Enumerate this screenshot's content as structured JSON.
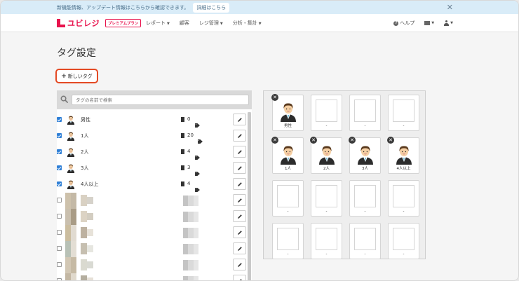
{
  "notice": {
    "text": "新機能情報、アップデート情報はこちらから確認できます。",
    "detail_label": "詳細はこちら",
    "close_label": "✕"
  },
  "nav": {
    "logo_text": "ユビレジ",
    "plan_badge": "プレミアムプラン",
    "menu": [
      {
        "label": "レポート",
        "caret": "▼"
      },
      {
        "label": "顧客",
        "caret": ""
      },
      {
        "label": "レジ管理",
        "caret": "▼"
      },
      {
        "label": "分析・集計",
        "caret": "▼"
      }
    ],
    "help_label": "ヘルプ",
    "caret": "▼"
  },
  "page": {
    "title": "タグ設定",
    "new_tag_label": "新しいタグ",
    "new_tag_plus": "+"
  },
  "search": {
    "placeholder": "タグの名前で検索"
  },
  "tags": [
    {
      "name": "男性",
      "count": "0",
      "checked": true
    },
    {
      "name": "1人",
      "count": "20",
      "checked": true
    },
    {
      "name": "2人",
      "count": "4",
      "checked": true
    },
    {
      "name": "3人",
      "count": "3",
      "checked": true
    },
    {
      "name": "4人以上",
      "count": "4",
      "checked": true
    },
    {
      "name": "",
      "count": "",
      "checked": false
    },
    {
      "name": "",
      "count": "",
      "checked": false
    },
    {
      "name": "",
      "count": "",
      "checked": false
    },
    {
      "name": "",
      "count": "",
      "checked": false
    },
    {
      "name": "",
      "count": "",
      "checked": false
    },
    {
      "name": "",
      "count": "",
      "checked": false
    }
  ],
  "grid": {
    "rows": [
      [
        {
          "label": "男性",
          "filled": true
        },
        {
          "label": "-",
          "filled": false
        },
        {
          "label": "-",
          "filled": false
        },
        {
          "label": "-",
          "filled": false
        }
      ],
      [
        {
          "label": "1人",
          "filled": true
        },
        {
          "label": "2人",
          "filled": true
        },
        {
          "label": "3人",
          "filled": true
        },
        {
          "label": "4人以上",
          "filled": true
        }
      ],
      [
        {
          "label": "-",
          "filled": false
        },
        {
          "label": "-",
          "filled": false
        },
        {
          "label": "-",
          "filled": false
        },
        {
          "label": "-",
          "filled": false
        }
      ],
      [
        {
          "label": "-",
          "filled": false
        },
        {
          "label": "-",
          "filled": false
        },
        {
          "label": "-",
          "filled": false
        },
        {
          "label": "-",
          "filled": false
        }
      ]
    ],
    "remove_glyph": "✕"
  },
  "colors": {
    "brand": "#e8134d",
    "highlight": "#e44a24",
    "checkbox": "#2f7fd6"
  }
}
